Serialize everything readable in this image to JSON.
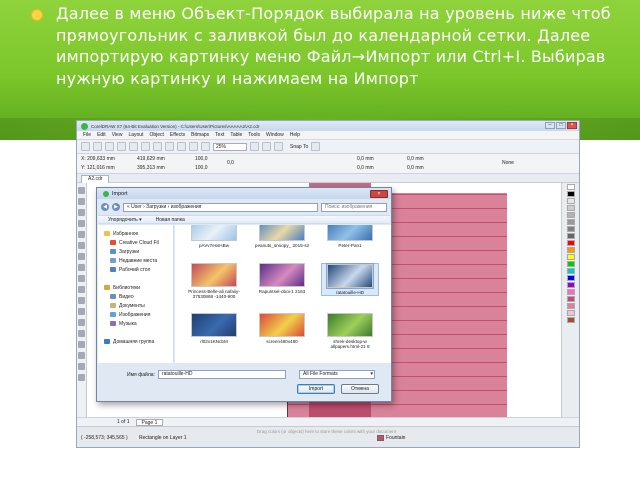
{
  "slide": {
    "text": "Далее в меню Объект-Порядок выбирала на уровень ниже чтоб прямоугольник с заливкой был до календарной сетки. Далее импортирую картинку меню Файл→Импорт или Ctrl+I. Выбирав нужную картинку и нажимаем на Импорт"
  },
  "app": {
    "title": "CorelDRAW X7 (64-Bit Evaluation Version) - C:\\Users\\User\\Pictures\\AAAAA2\\A2.cdr",
    "menu": [
      "File",
      "Edit",
      "View",
      "Layout",
      "Object",
      "Effects",
      "Bitmaps",
      "Text",
      "Table",
      "Tools",
      "Window",
      "Help"
    ],
    "zoom": "25%",
    "snap_to": "Snap To",
    "props": {
      "x": "X: 209,633 mm",
      "y": "Y: 121,016 mm",
      "w": "419,629 mm",
      "h": "395,313 mm",
      "sx": "100,0",
      "sy": "100,0",
      "angle": "0,0",
      "pos1": "0,0 mm",
      "pos2": "0,0 mm",
      "pos3": "0,0 mm",
      "pos4": "0,0 mm",
      "outline": "None"
    },
    "doc_tab": "A2.cdr",
    "page_nav": "1 of 1",
    "page_tab": "Page 1",
    "status": {
      "coords": "( -258,573; 345,565 )",
      "object": "Rectangle on Layer 1",
      "hint": "Drag colors (or objects) here to store these colors with your document",
      "fill": "Fountain",
      "fill_color": "#c0506e"
    }
  },
  "dialog": {
    "title": "Import",
    "close": "×",
    "path": "« User › Загрузки › изображения",
    "search_placeholder": "Поиск: изображения",
    "cmd": {
      "organize": "Упорядочить ▾",
      "new_folder": "Новая папка"
    },
    "nav": [
      {
        "label": "Избранное",
        "sub": false,
        "color": "#f2c04a"
      },
      {
        "label": "Creative Cloud Fil",
        "sub": true,
        "color": "#e34b3a"
      },
      {
        "label": "Загрузки",
        "sub": true,
        "color": "#5a8fd6"
      },
      {
        "label": "Недавние места",
        "sub": true,
        "color": "#7a9cc6"
      },
      {
        "label": "Рабочий стол",
        "sub": true,
        "color": "#4f80c4"
      },
      {
        "label": "",
        "sub": false,
        "color": "transparent"
      },
      {
        "label": "Библиотеки",
        "sub": false,
        "color": "#d9a73c"
      },
      {
        "label": "Видео",
        "sub": true,
        "color": "#6f8fb8"
      },
      {
        "label": "Документы",
        "sub": true,
        "color": "#c9b27a"
      },
      {
        "label": "Изображения",
        "sub": true,
        "color": "#5fa3d9"
      },
      {
        "label": "Музыка",
        "sub": true,
        "color": "#8a6cc0"
      },
      {
        "label": "",
        "sub": false,
        "color": "transparent"
      },
      {
        "label": "Домашняя группа",
        "sub": false,
        "color": "#3a7bc8"
      }
    ],
    "files": [
      {
        "name": "pAVv7essHBw",
        "c1": "#9cc3e6",
        "c2": "#e9f1f8",
        "selected": false
      },
      {
        "name": "peanuts_snoopy_ 2015-s2",
        "c1": "#4a7fc0",
        "c2": "#e8d9a8",
        "selected": false
      },
      {
        "name": "Peter-Pan1",
        "c1": "#3b6fb0",
        "c2": "#8fc1e8",
        "selected": false
      },
      {
        "name": "Princess-Belle-ali nafaiiy-37530868 -1440-900",
        "c1": "#c34a5a",
        "c2": "#f3c56a",
        "selected": false
      },
      {
        "name": "Rapuntsel-oboi-1 2163",
        "c1": "#5b2f86",
        "c2": "#d68ac0",
        "selected": false
      },
      {
        "name": "ratatouille-HD",
        "c1": "#24497a",
        "c2": "#c9d9ec",
        "selected": true
      },
      {
        "name": "rl02x1KNcbM",
        "c1": "#1f3f6f",
        "c2": "#3a6ab0",
        "selected": false
      },
      {
        "name": "screen480x480",
        "c1": "#d94b3d",
        "c2": "#f2d04a",
        "selected": false
      },
      {
        "name": "shrek-desktop-w allpapers.html-21 8",
        "c1": "#3d7a2e",
        "c2": "#9fcf5a",
        "selected": false
      }
    ],
    "filename_label": "Имя файла:",
    "filename_value": "ratatouille-HD",
    "filetype": "All File Formats",
    "import_button": "Import",
    "cancel_button": "Отмена"
  }
}
